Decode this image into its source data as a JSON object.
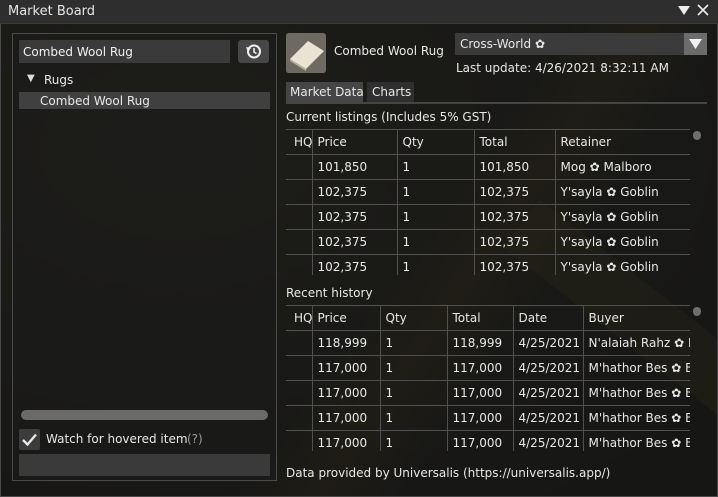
{
  "window": {
    "title": "Market Board"
  },
  "search": {
    "value": "Combed Wool Rug"
  },
  "tree": {
    "category": "Rugs",
    "selected_item": "Combed Wool Rug"
  },
  "watch": {
    "label": "Watch for hovered item",
    "help": "(?)",
    "checked": true
  },
  "item": {
    "name": "Combed Wool Rug"
  },
  "world": {
    "selected": "Cross-World",
    "symbol": "✿"
  },
  "last_update": "Last update: 4/26/2021 8:32:11 AM",
  "tabs": [
    {
      "label": "Market Data",
      "active": true
    },
    {
      "label": "Charts",
      "active": false
    }
  ],
  "listings": {
    "title": "Current listings (Includes 5% GST)",
    "headers": [
      "HQ",
      "Price",
      "Qty",
      "Total",
      "Retainer"
    ],
    "rows": [
      {
        "hq": "",
        "price": "101,850",
        "qty": "1",
        "total": "101,850",
        "name": "Mog",
        "world": "Malboro"
      },
      {
        "hq": "",
        "price": "102,375",
        "qty": "1",
        "total": "102,375",
        "name": "Y'sayla",
        "world": "Goblin"
      },
      {
        "hq": "",
        "price": "102,375",
        "qty": "1",
        "total": "102,375",
        "name": "Y'sayla",
        "world": "Goblin"
      },
      {
        "hq": "",
        "price": "102,375",
        "qty": "1",
        "total": "102,375",
        "name": "Y'sayla",
        "world": "Goblin"
      },
      {
        "hq": "",
        "price": "102,375",
        "qty": "1",
        "total": "102,375",
        "name": "Y'sayla",
        "world": "Goblin"
      }
    ]
  },
  "history": {
    "title": "Recent history",
    "headers": [
      "HQ",
      "Price",
      "Qty",
      "Total",
      "Date",
      "Buyer"
    ],
    "rows": [
      {
        "hq": "",
        "price": "118,999",
        "qty": "1",
        "total": "118,999",
        "date": "4/25/2021",
        "name": "N'alaiah Rahz",
        "world": "Ba"
      },
      {
        "hq": "",
        "price": "117,000",
        "qty": "1",
        "total": "117,000",
        "date": "4/25/2021",
        "name": "M'hathor Bes",
        "world": "Ba"
      },
      {
        "hq": "",
        "price": "117,000",
        "qty": "1",
        "total": "117,000",
        "date": "4/25/2021",
        "name": "M'hathor Bes",
        "world": "Ba"
      },
      {
        "hq": "",
        "price": "117,000",
        "qty": "1",
        "total": "117,000",
        "date": "4/25/2021",
        "name": "M'hathor Bes",
        "world": "Ba"
      },
      {
        "hq": "",
        "price": "117,000",
        "qty": "1",
        "total": "117,000",
        "date": "4/25/2021",
        "name": "M'hathor Bes",
        "world": "Ba"
      }
    ]
  },
  "footer": "Data provided by Universalis (https://universalis.app/)"
}
